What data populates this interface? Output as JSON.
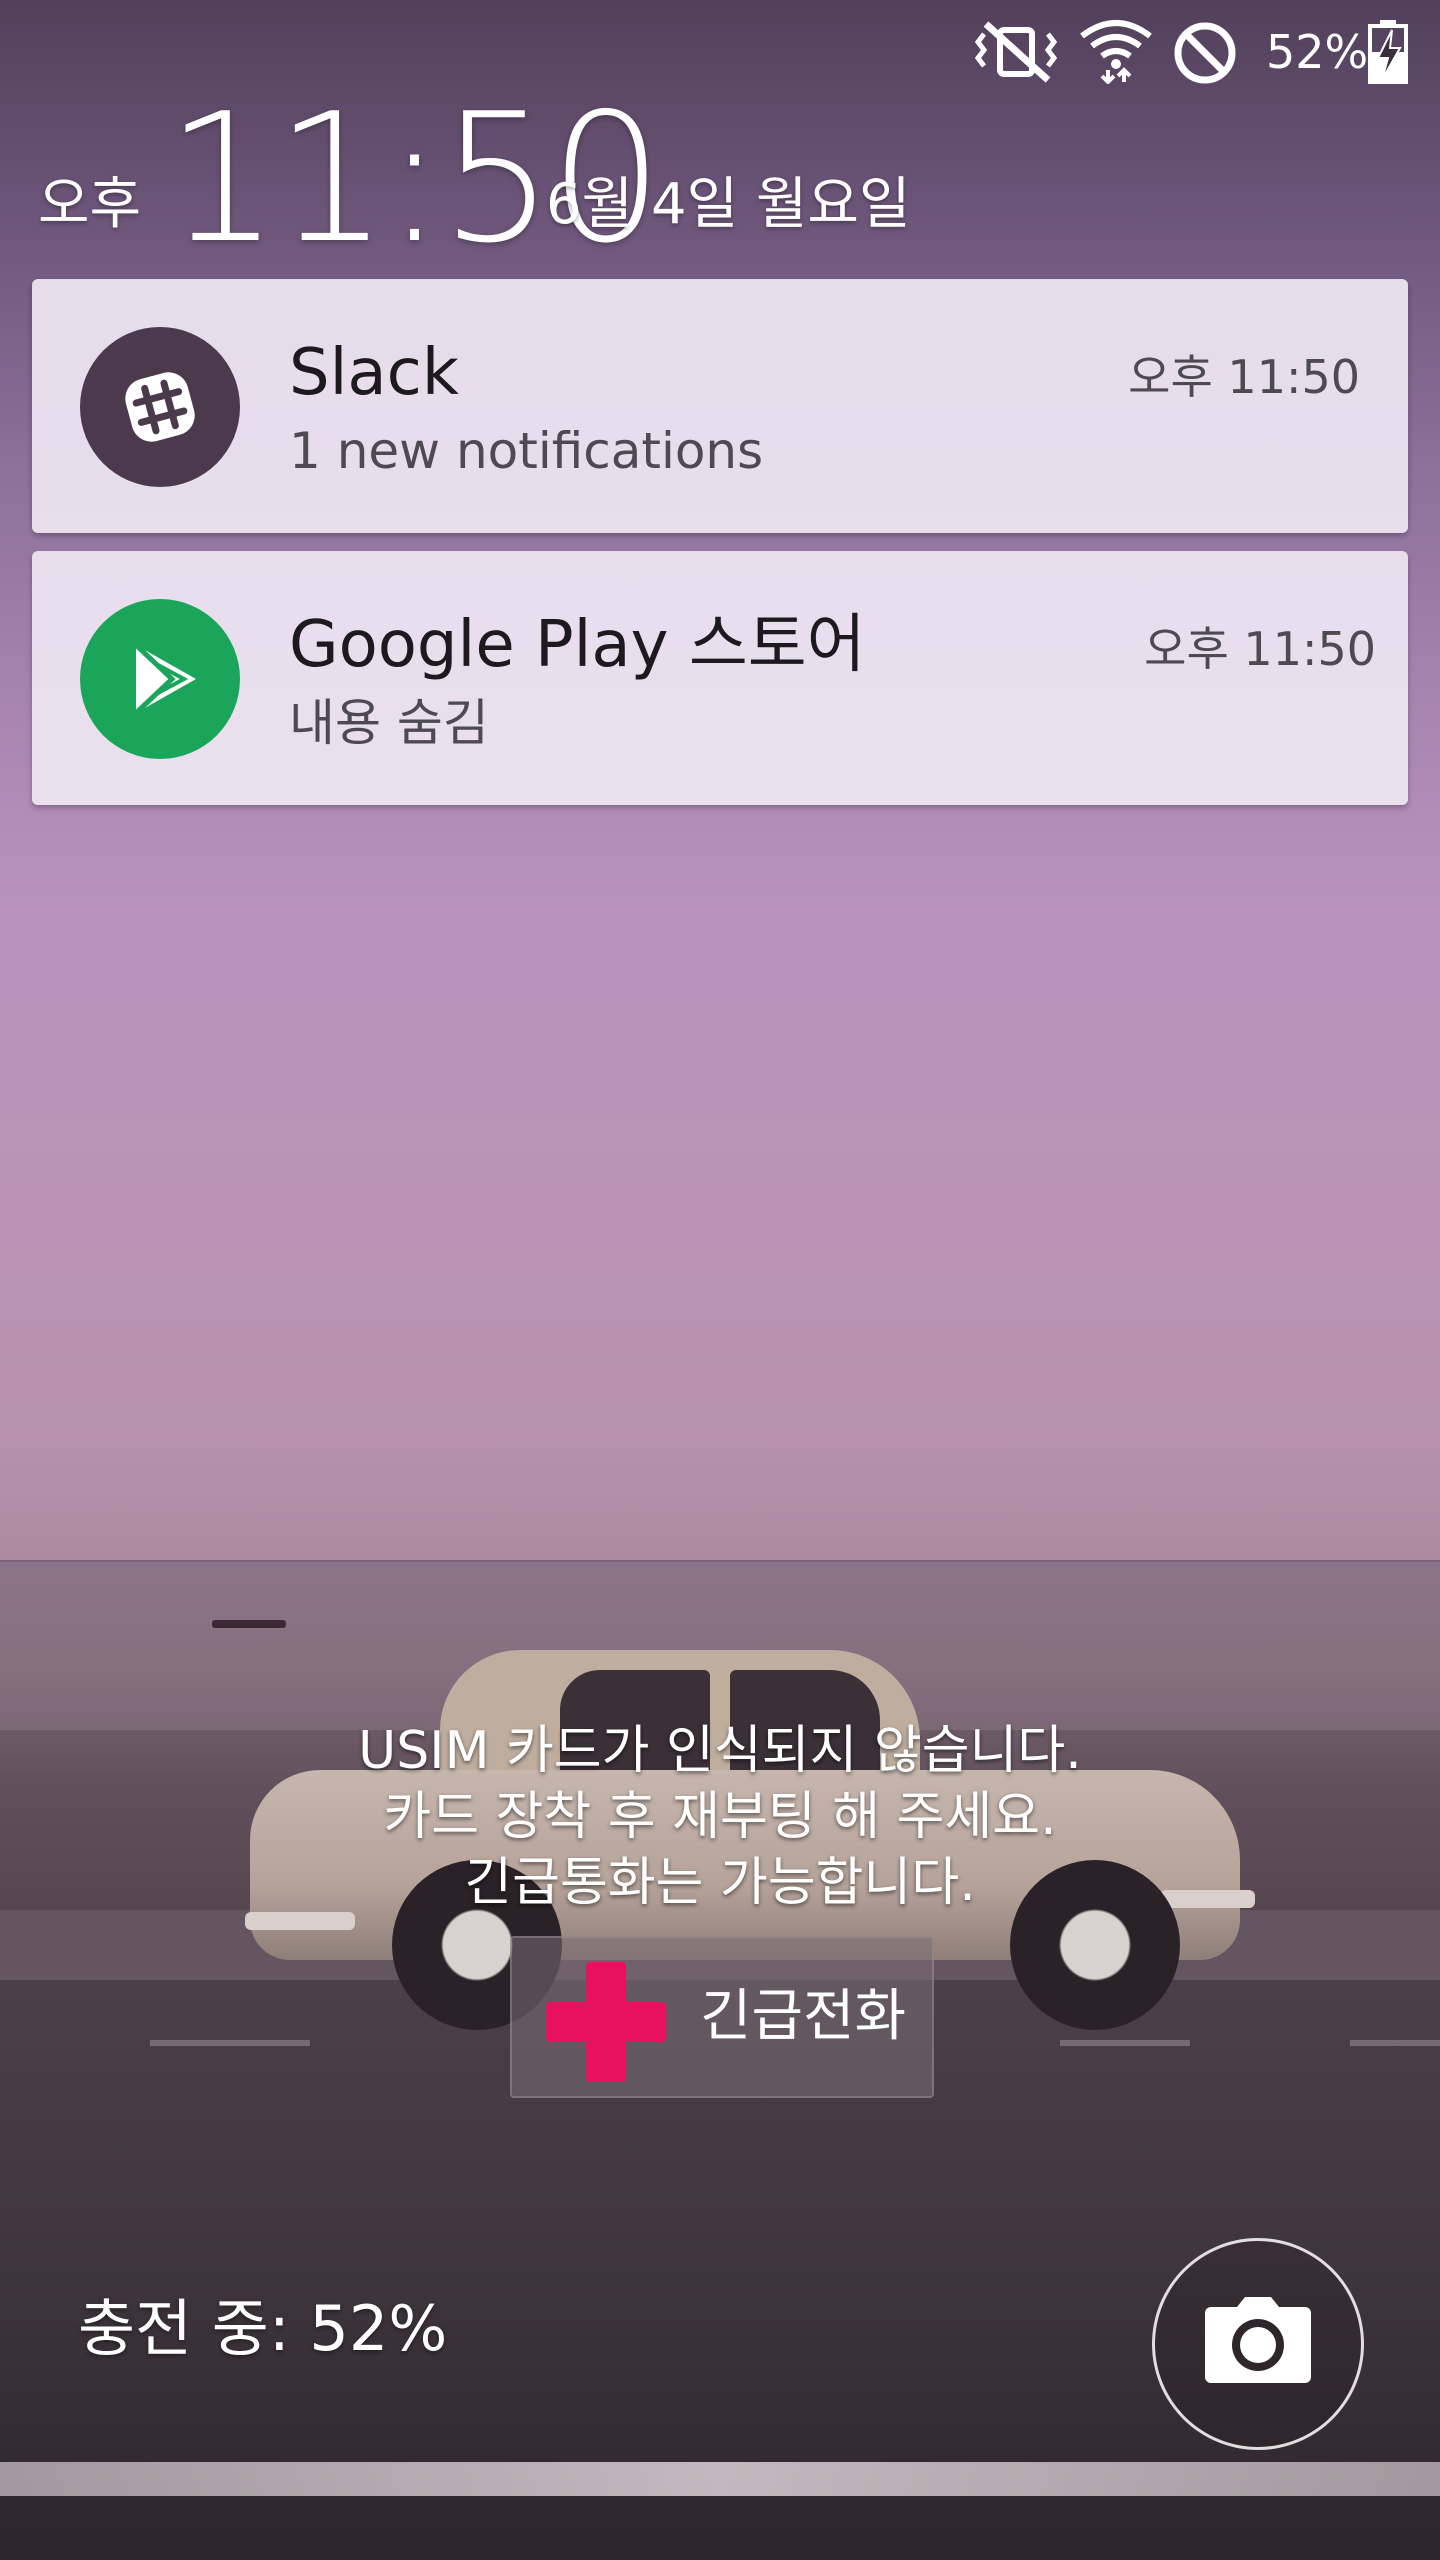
{
  "status_bar": {
    "battery_percent": "52%",
    "icons": [
      "vibrate-mute-icon",
      "wifi-icon",
      "do-not-disturb-icon",
      "battery-charging-icon"
    ],
    "battery_level": 0.52
  },
  "lock_clock": {
    "ampm": "오후",
    "time": "11:50",
    "date": "6월 4일 월요일"
  },
  "notifications": [
    {
      "app": "Slack",
      "text": "1 new notifications",
      "time": "오후 11:50",
      "icon": "slack-icon",
      "icon_color": "#4a3a4c"
    },
    {
      "app": "Google Play 스토어",
      "text": "내용 숨김",
      "time": "오후 11:50",
      "icon": "play-store-icon",
      "icon_color": "#1aa55b"
    }
  ],
  "sim_message": {
    "line1": "USIM 카드가 인식되지 않습니다.",
    "line2": "카드 장착 후 재부팅 해 주세요.",
    "line3": "긴급통화는 가능합니다."
  },
  "emergency_call": {
    "label": "긴급전화",
    "icon": "red-cross-icon",
    "icon_color": "#e8125c"
  },
  "charging": {
    "text": "충전 중: 52%"
  },
  "camera_shortcut": {
    "icon": "camera-icon"
  }
}
